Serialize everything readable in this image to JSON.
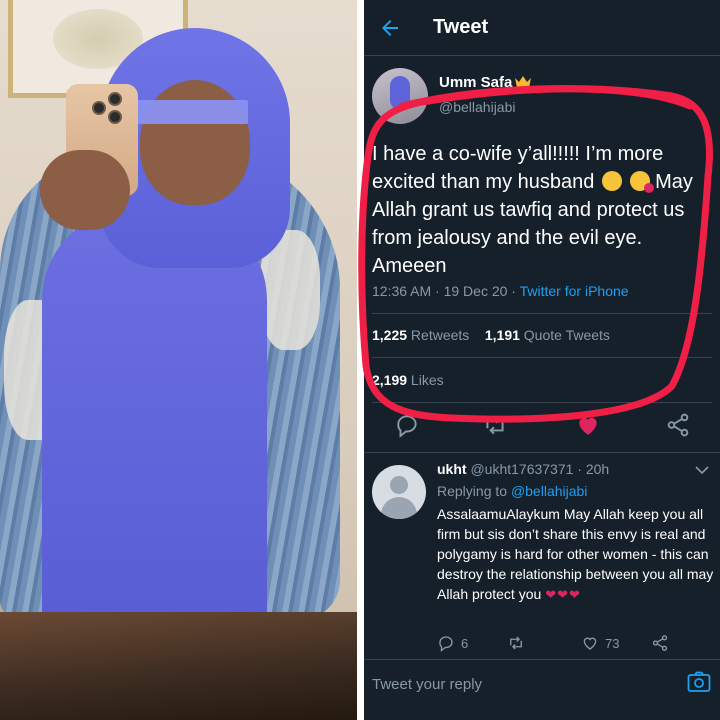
{
  "header": {
    "title": "Tweet"
  },
  "tweet": {
    "author_name": "Umm Safa",
    "author_handle": "@bellahijabi",
    "text": "I have a co-wife y’all!!!!! I’m more excited than my husband",
    "text_cont": "May Allah grant us tawfiq and protect us from jealousy and the evil eye. Ameeen",
    "time": "12:36 AM · 19 Dec 20 · ",
    "source": "Twitter for iPhone",
    "retweets_count": "1,225",
    "retweets_label": " Retweets",
    "quotes_count": "1,191",
    "quotes_label": " Quote Tweets",
    "likes_count": "2,199",
    "likes_label": " Likes"
  },
  "reply": {
    "name": "ukht",
    "handle": "@ukht17637371",
    "time": " · 20h",
    "replying_label": "Replying to ",
    "replying_to": "@bellahijabi",
    "text": "AssalaamuAlaykum May Allah keep you all firm but sis don’t share this envy is real and polygamy is hard for other women - this can destroy the relationship between you all may Allah protect you",
    "hearts": "❤❤❤",
    "reply_count": "6",
    "like_count": "73"
  },
  "compose": {
    "placeholder": "Tweet your reply"
  },
  "colors": {
    "background": "#15202b",
    "accent": "#1da1f2",
    "like": "#e0245e",
    "highlight": "#ef1f45",
    "muted": "#8899a6"
  },
  "icons": [
    "back-arrow-icon",
    "crown-icon",
    "reply-icon",
    "retweet-icon",
    "heart-icon",
    "share-icon",
    "chevron-down-icon",
    "camera-icon"
  ]
}
